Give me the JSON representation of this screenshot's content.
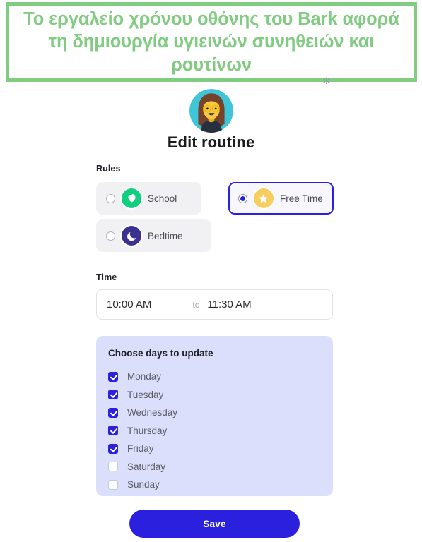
{
  "banner": {
    "text": "Το εργαλείο χρόνου οθόνης του Bark αφορά τη δημιουργία υγιεινών συνηθειών και ρουτίνων",
    "border_color": "#80cc80",
    "text_color": "#82cb82",
    "artifact_glyph": "✻"
  },
  "avatar": {
    "icon_name": "user-avatar",
    "background_color": "#3ec6d8",
    "hair_color": "#77422c",
    "skin_color": "#f6c944",
    "shirt_color": "#27303f"
  },
  "page_title": "Edit routine",
  "rules": {
    "label": "Rules",
    "options": [
      {
        "label": "School",
        "icon_name": "apple-icon",
        "icon_color": "#10d07f",
        "selected": false
      },
      {
        "label": "Free Time",
        "icon_name": "star-icon",
        "icon_color": "#f5ce5f",
        "selected": true
      },
      {
        "label": "Bedtime",
        "icon_name": "moon-icon",
        "icon_color": "#3b3290",
        "selected": false
      }
    ]
  },
  "time": {
    "label": "Time",
    "start": "10:00 AM",
    "separator": "to",
    "end": "11:30 AM"
  },
  "days": {
    "title": "Choose days to update",
    "panel_color": "#dbdffb",
    "items": [
      {
        "label": "Monday",
        "checked": true
      },
      {
        "label": "Tuesday",
        "checked": true
      },
      {
        "label": "Wednesday",
        "checked": true
      },
      {
        "label": "Thursday",
        "checked": true
      },
      {
        "label": "Friday",
        "checked": true
      },
      {
        "label": "Saturday",
        "checked": false
      },
      {
        "label": "Sunday",
        "checked": false
      }
    ]
  },
  "save": {
    "label": "Save",
    "color": "#2a20dd"
  }
}
